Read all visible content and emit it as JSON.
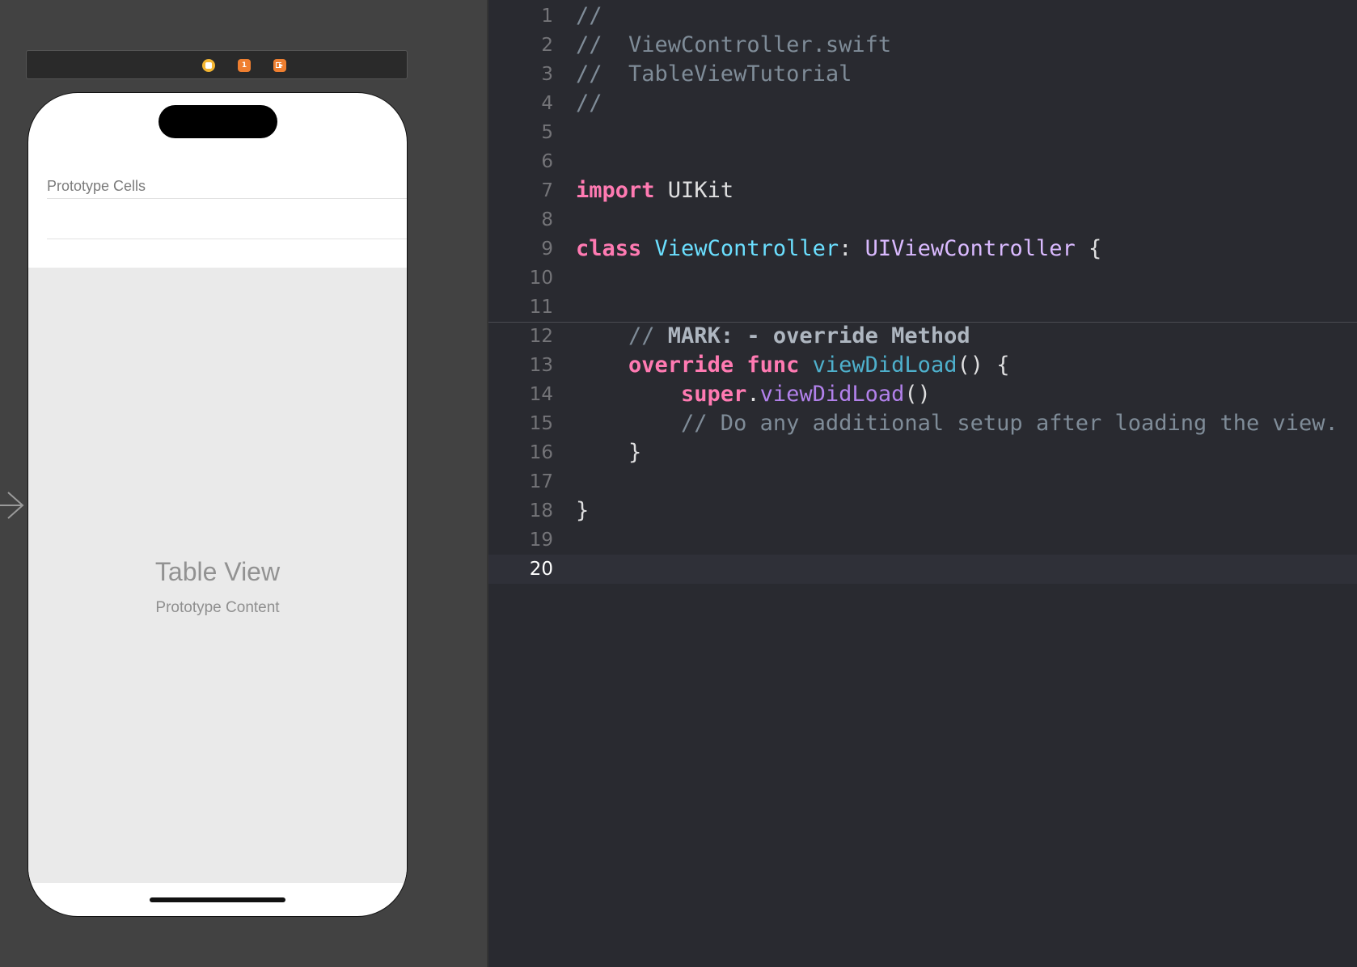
{
  "storyboard": {
    "cells_header": "Prototype Cells",
    "table_title": "Table View",
    "table_subtitle": "Prototype Content",
    "dock": {
      "fr_label": "1"
    }
  },
  "editor": {
    "current_line": 20,
    "line_numbers": [
      "1",
      "2",
      "3",
      "4",
      "5",
      "6",
      "7",
      "8",
      "9",
      "10",
      "11",
      "12",
      "13",
      "14",
      "15",
      "16",
      "17",
      "18",
      "19",
      "20"
    ],
    "lines": [
      [
        {
          "t": "//",
          "c": "com"
        }
      ],
      [
        {
          "t": "//  ViewController.swift",
          "c": "com"
        }
      ],
      [
        {
          "t": "//  TableViewTutorial",
          "c": "com"
        }
      ],
      [
        {
          "t": "//",
          "c": "com"
        }
      ],
      [],
      [],
      [
        {
          "t": "import",
          "c": "kw"
        },
        {
          "t": " UIKit",
          "c": "plain"
        }
      ],
      [],
      [
        {
          "t": "class",
          "c": "kw"
        },
        {
          "t": " ",
          "c": "plain"
        },
        {
          "t": "ViewController",
          "c": "decl"
        },
        {
          "t": ": ",
          "c": "plain"
        },
        {
          "t": "UIViewController",
          "c": "type"
        },
        {
          "t": " {",
          "c": "plain"
        }
      ],
      [],
      [],
      [
        {
          "t": "    // ",
          "c": "com"
        },
        {
          "t": "MARK: - override Method",
          "c": "mark"
        }
      ],
      [
        {
          "t": "    ",
          "c": "plain"
        },
        {
          "t": "override",
          "c": "kw"
        },
        {
          "t": " ",
          "c": "plain"
        },
        {
          "t": "func",
          "c": "kw"
        },
        {
          "t": " ",
          "c": "plain"
        },
        {
          "t": "viewDidLoad",
          "c": "fn"
        },
        {
          "t": "() {",
          "c": "plain"
        }
      ],
      [
        {
          "t": "        ",
          "c": "plain"
        },
        {
          "t": "super",
          "c": "kw"
        },
        {
          "t": ".",
          "c": "plain"
        },
        {
          "t": "viewDidLoad",
          "c": "call"
        },
        {
          "t": "()",
          "c": "plain"
        }
      ],
      [
        {
          "t": "        // Do any additional setup after loading the view.",
          "c": "com"
        }
      ],
      [
        {
          "t": "    }",
          "c": "plain"
        }
      ],
      [],
      [
        {
          "t": "}",
          "c": "plain"
        }
      ],
      [],
      []
    ]
  },
  "colors": {
    "canvas": "#424242",
    "editor_bg": "#292a30",
    "keyword": "#ff7ab2",
    "comment": "#7f8c98",
    "declaration": "#6bdfff",
    "type": "#dabaff",
    "function_decl": "#4eb0cc",
    "function_call": "#b281eb"
  },
  "icons": [
    "view-controller-icon",
    "first-responder-icon",
    "exit-icon",
    "entry-point-arrow-icon"
  ]
}
